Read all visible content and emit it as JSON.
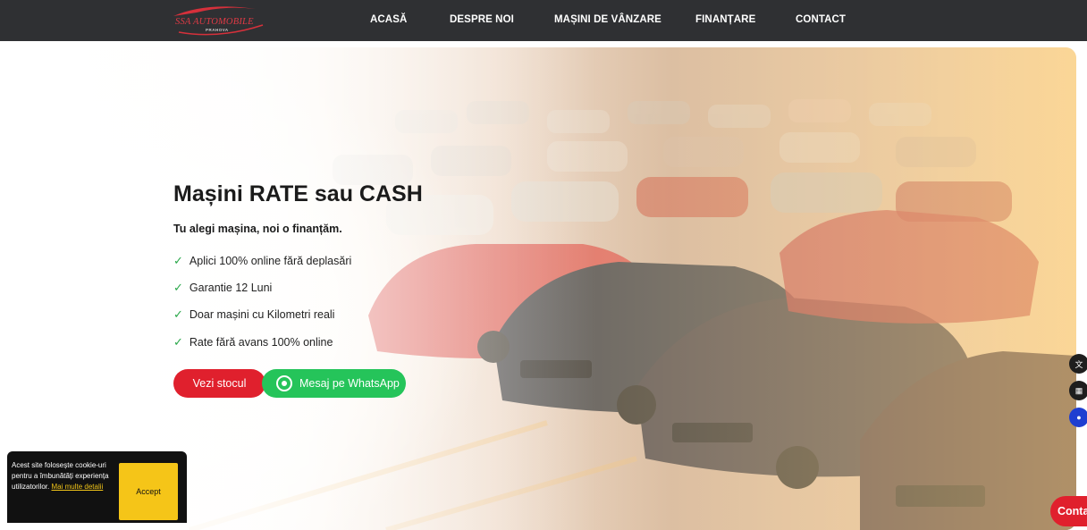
{
  "nav": {
    "logo_text": "SSA AUTOMOBILE",
    "logo_sub": "PRAHOVA",
    "items": [
      {
        "label": "ACASĂ"
      },
      {
        "label": "DESPRE NOI"
      },
      {
        "label": "MAȘINI DE VÂNZARE"
      },
      {
        "label": "FINANȚARE"
      },
      {
        "label": "CONTACT"
      }
    ]
  },
  "hero": {
    "title": "Mașini RATE sau CASH",
    "subtitle": "Tu alegi mașina, noi o finanțăm.",
    "features": [
      "Aplici 100% online fără deplasări",
      "Garantie 12 Luni",
      "Doar mașini cu Kilometri reali",
      "Rate fără avans 100% online"
    ],
    "stock_button": "Vezi stocul",
    "whatsapp_button": "Mesaj pe WhatsApp"
  },
  "icons": {
    "check": "✓",
    "whatsapp": "whatsapp-icon",
    "translate": "translate-icon",
    "grid": "grid-icon",
    "assistant": "chat-bot-icon"
  },
  "cookie": {
    "text": "Acest site folosește cookie-uri pentru a îmbunătăți experiența utilizatorilor.",
    "link": "Mai multe detalii",
    "accept": "Accept"
  },
  "contact_button": "Contact",
  "colors": {
    "nav_bg": "#2f3033",
    "primary_red": "#e0202d",
    "whatsapp_green": "#25c45a",
    "cookie_bg": "#111111",
    "accept_yellow": "#f5c518"
  }
}
